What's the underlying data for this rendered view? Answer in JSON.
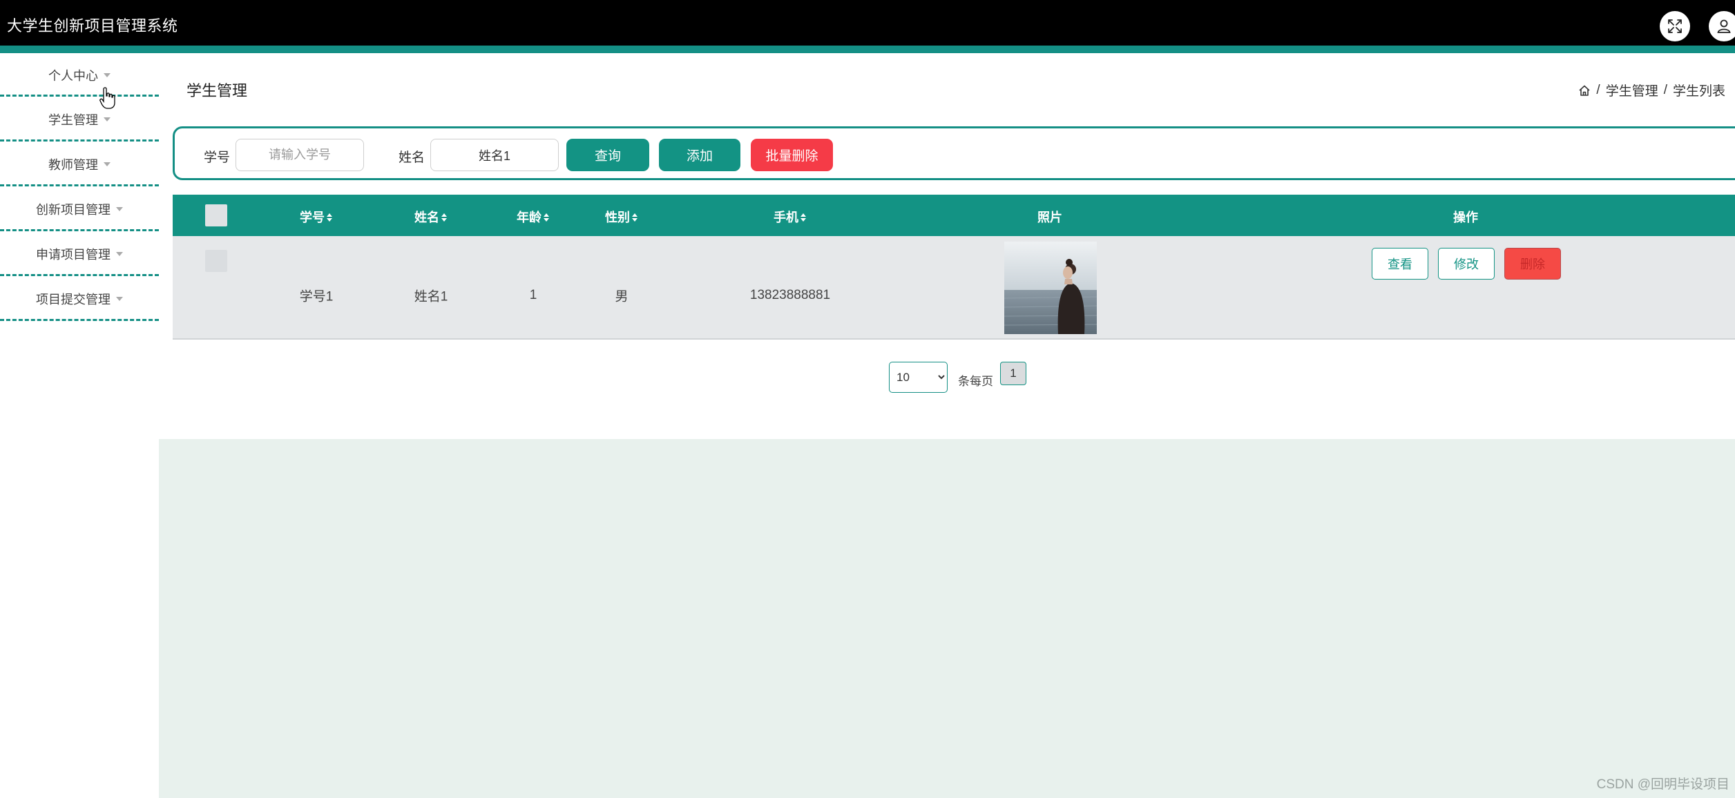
{
  "app": {
    "title": "大学生创新项目管理系统"
  },
  "topbar": {
    "fullscreen_icon": "fullscreen-icon",
    "user_icon": "user-icon"
  },
  "sidebar": {
    "items": [
      {
        "label": "个人中心"
      },
      {
        "label": "学生管理"
      },
      {
        "label": "教师管理"
      },
      {
        "label": "创新项目管理"
      },
      {
        "label": "申请项目管理"
      },
      {
        "label": "项目提交管理"
      }
    ]
  },
  "page": {
    "title": "学生管理"
  },
  "breadcrumb": {
    "home_icon": "home-icon",
    "sep": "/",
    "level1": "学生管理",
    "level2": "学生列表"
  },
  "search": {
    "student_no_label": "学号",
    "student_no_placeholder": "请输入学号",
    "student_no_value": "",
    "name_label": "姓名",
    "name_value": "姓名1",
    "query_label": "查询",
    "add_label": "添加",
    "batch_delete_label": "批量删除"
  },
  "table": {
    "headers": {
      "student_no": "学号",
      "name": "姓名",
      "age": "年龄",
      "gender": "性别",
      "phone": "手机",
      "photo": "照片",
      "actions": "操作"
    },
    "rows": [
      {
        "student_no": "学号1",
        "name": "姓名1",
        "age": "1",
        "gender": "男",
        "phone": "13823888881"
      }
    ],
    "row_actions": {
      "view": "查看",
      "edit": "修改",
      "delete": "删除"
    }
  },
  "pagination": {
    "page_size": "10",
    "page_size_options": [
      "10"
    ],
    "per_page_label": "条每页",
    "current_page": "1"
  },
  "watermark": "CSDN @回明毕设项目",
  "colors": {
    "accent": "#139384",
    "danger": "#f53b47",
    "topbar": "#000000",
    "content_bg": "#e8f1ed"
  }
}
